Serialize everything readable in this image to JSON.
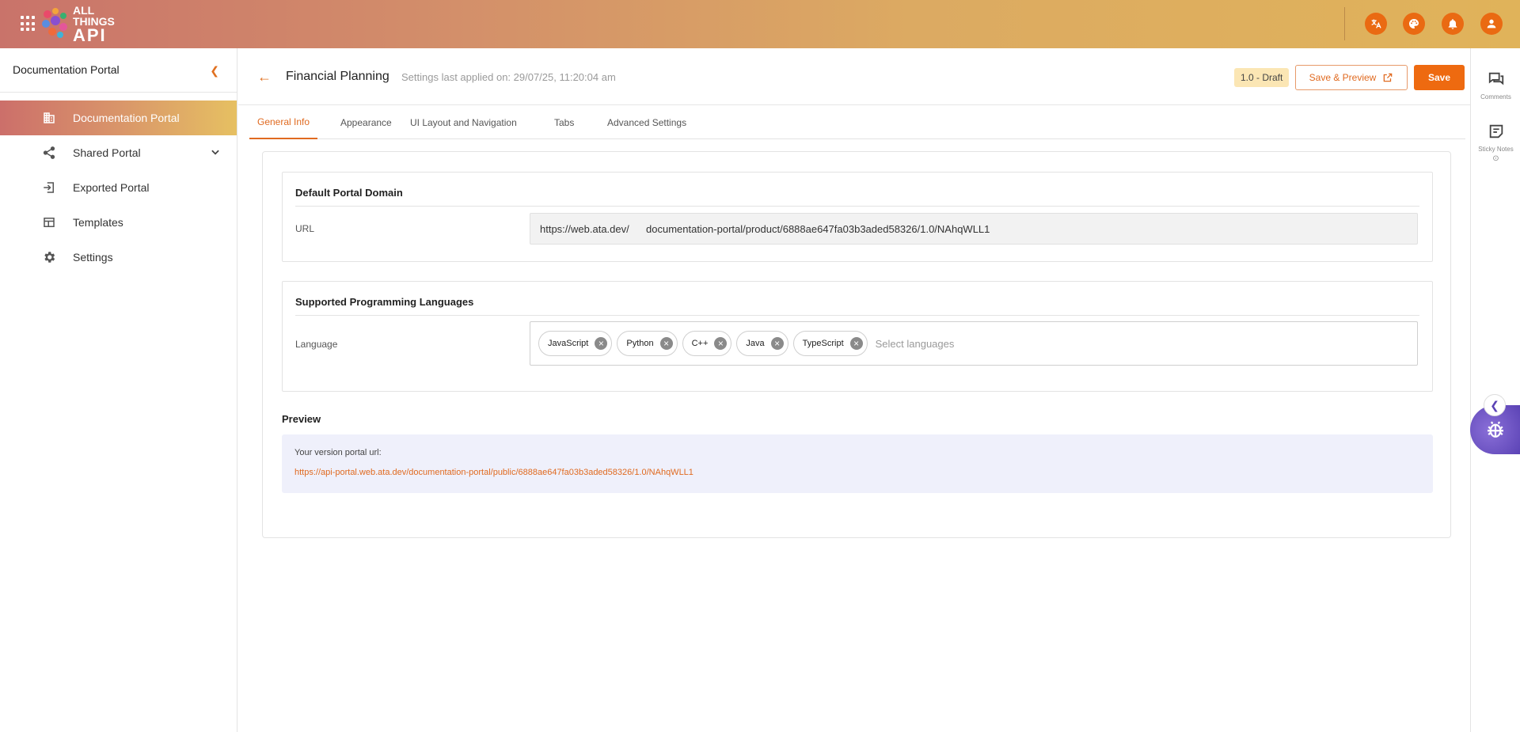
{
  "topbar": {
    "logo_line1": "ALL",
    "logo_line2": "THINGS",
    "logo_line3": "API",
    "icons": [
      "translate-icon",
      "palette-icon",
      "bell-icon",
      "account-icon"
    ],
    "accent": "#ea6a12"
  },
  "sidebar": {
    "title": "Documentation Portal",
    "items": [
      {
        "label": "Documentation Portal",
        "icon": "building-icon",
        "active": true
      },
      {
        "label": "Shared Portal",
        "icon": "share-icon",
        "expandable": true
      },
      {
        "label": "Exported Portal",
        "icon": "export-icon"
      },
      {
        "label": "Templates",
        "icon": "template-icon"
      },
      {
        "label": "Settings",
        "icon": "gear-icon"
      }
    ]
  },
  "header": {
    "title": "Financial Planning",
    "last_applied": "Settings last applied on: 29/07/25, 11:20:04 am",
    "version": "1.0 - Draft",
    "save_preview_label": "Save & Preview",
    "save_label": "Save"
  },
  "tabs": [
    "General Info",
    "Appearance",
    "UI Layout and Navigation",
    "Tabs",
    "Advanced Settings"
  ],
  "domain": {
    "title": "Default Portal Domain",
    "url_label": "URL",
    "url_prefix": "https://web.ata.dev/",
    "url_path": "documentation-portal/product/6888ae647fa03b3aded58326/1.0/NAhqWLL1"
  },
  "languages": {
    "title": "Supported Programming Languages",
    "label": "Language",
    "chips": [
      "JavaScript",
      "Python",
      "C++",
      "Java",
      "TypeScript"
    ],
    "placeholder": "Select languages"
  },
  "preview": {
    "title": "Preview",
    "label": "Your version portal url:",
    "link": "https://api-portal.web.ata.dev/documentation-portal/public/6888ae647fa03b3aded58326/1.0/NAhqWLL1"
  },
  "right_rail": {
    "comments_label": "Comments",
    "sticky_label": "Sticky Notes"
  }
}
